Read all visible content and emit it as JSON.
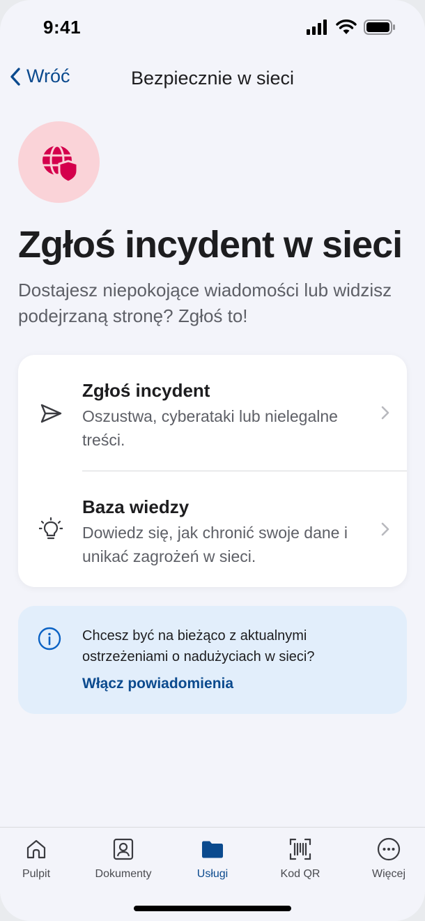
{
  "status_bar": {
    "time": "9:41"
  },
  "nav": {
    "back_label": "Wróć",
    "title": "Bezpiecznie w sieci"
  },
  "hero": {
    "icon": "globe-shield-icon",
    "title": "Zgłoś incydent w sieci",
    "subtitle": "Dostajesz niepokojące wiadomości lub widzisz podejrzaną stronę? Zgłoś to!"
  },
  "options": [
    {
      "icon": "send-icon",
      "title": "Zgłoś incydent",
      "description": "Oszustwa, cyberataki lub nielegalne treści."
    },
    {
      "icon": "lightbulb-icon",
      "title": "Baza wiedzy",
      "description": "Dowiedz się, jak chronić swoje dane i unikać zagrożeń w sieci."
    }
  ],
  "info": {
    "icon": "info-icon",
    "text": "Chcesz być na bieżąco z aktualnymi ostrzeżeniami o nadużyciach w sieci?",
    "link": "Włącz powiadomienia"
  },
  "tabs": [
    {
      "label": "Pulpit",
      "icon": "home-icon"
    },
    {
      "label": "Dokumenty",
      "icon": "id-card-icon"
    },
    {
      "label": "Usługi",
      "icon": "folder-icon",
      "active": true
    },
    {
      "label": "Kod QR",
      "icon": "qr-scan-icon"
    },
    {
      "label": "Więcej",
      "icon": "more-icon"
    }
  ],
  "colors": {
    "accent": "#0b4a8e",
    "brand_red": "#d4004c",
    "hero_bg": "#fad3d8",
    "info_bg": "#e2eefb"
  }
}
